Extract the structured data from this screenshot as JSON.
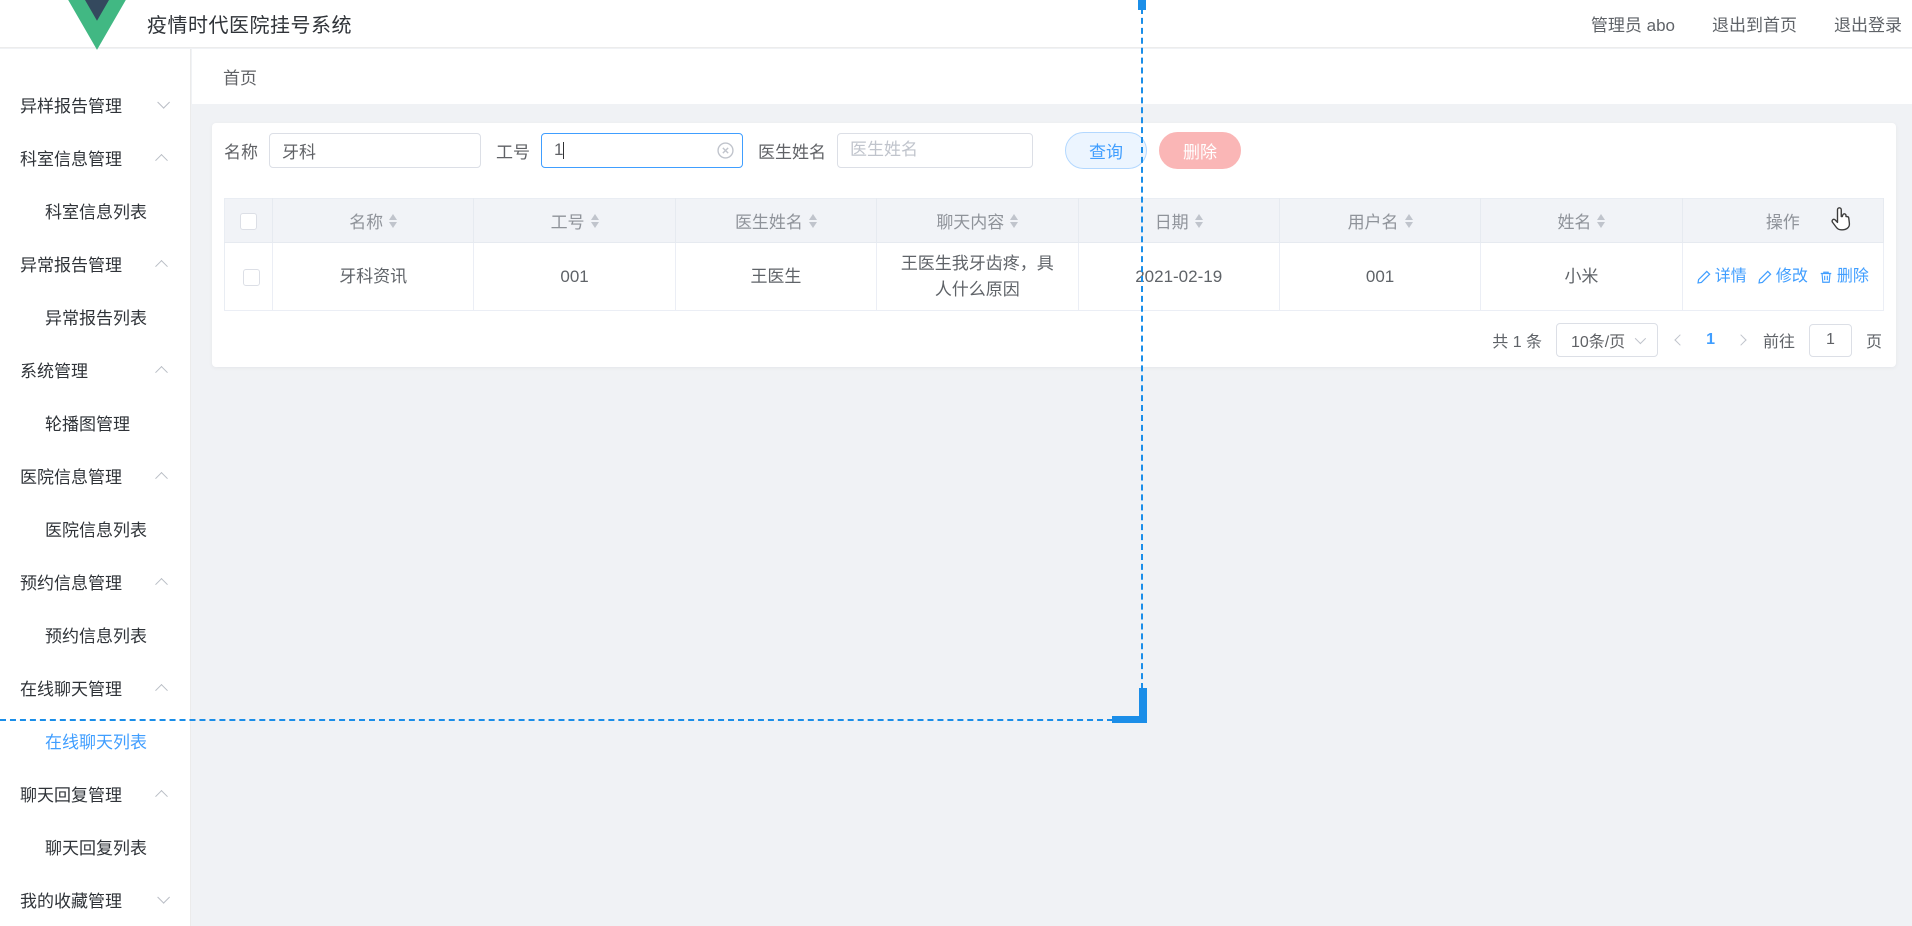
{
  "header": {
    "title": "疫情时代医院挂号系统",
    "user": "管理员 abo",
    "exit_home": "退出到首页",
    "logout": "退出登录"
  },
  "breadcrumb": {
    "home": "首页"
  },
  "sidebar": {
    "items": [
      {
        "label": "异样报告管理",
        "type": "parent",
        "state": "collapsed"
      },
      {
        "label": "科室信息管理",
        "type": "parent",
        "state": "expanded"
      },
      {
        "label": "科室信息列表",
        "type": "child",
        "active": false
      },
      {
        "label": "异常报告管理",
        "type": "parent",
        "state": "expanded"
      },
      {
        "label": "异常报告列表",
        "type": "child",
        "active": false
      },
      {
        "label": "系统管理",
        "type": "parent",
        "state": "expanded"
      },
      {
        "label": "轮播图管理",
        "type": "child",
        "active": false
      },
      {
        "label": "医院信息管理",
        "type": "parent",
        "state": "expanded"
      },
      {
        "label": "医院信息列表",
        "type": "child",
        "active": false
      },
      {
        "label": "预约信息管理",
        "type": "parent",
        "state": "expanded"
      },
      {
        "label": "预约信息列表",
        "type": "child",
        "active": false
      },
      {
        "label": "在线聊天管理",
        "type": "parent",
        "state": "expanded"
      },
      {
        "label": "在线聊天列表",
        "type": "child",
        "active": true
      },
      {
        "label": "聊天回复管理",
        "type": "parent",
        "state": "expanded"
      },
      {
        "label": "聊天回复列表",
        "type": "child",
        "active": false
      },
      {
        "label": "我的收藏管理",
        "type": "parent",
        "state": "collapsed"
      }
    ]
  },
  "search": {
    "name_label": "名称",
    "name_value": "牙科",
    "worker_label": "工号",
    "worker_value": "1",
    "doctor_label": "医生姓名",
    "doctor_placeholder": "医生姓名",
    "query_button": "查询",
    "delete_button": "删除"
  },
  "table": {
    "columns": [
      "名称",
      "工号",
      "医生姓名",
      "聊天内容",
      "日期",
      "用户名",
      "姓名",
      "操作"
    ],
    "rows": [
      {
        "name": "牙科资讯",
        "worker_id": "001",
        "doctor": "王医生",
        "content": "王医生我牙齿疼，具人什么原因",
        "date": "2021-02-19",
        "username": "001",
        "realname": "小米"
      }
    ],
    "actions": {
      "detail": "详情",
      "edit": "修改",
      "delete": "删除"
    }
  },
  "pagination": {
    "total": "共 1 条",
    "page_size": "10条/页",
    "current": "1",
    "goto_label": "前往",
    "goto_value": "1",
    "page_label": "页"
  },
  "icons": {
    "logo": "vue-logo",
    "input_clear": "circle-close",
    "sort": "sort-carets",
    "detail": "edit-pencil",
    "edit": "edit-pencil",
    "delete": "trash",
    "page_size_arrow": "chevron-down",
    "prev": "chevron-left",
    "next": "chevron-right",
    "overlay": "selection-crosshair",
    "cursor": "hand-pointer"
  },
  "colors": {
    "primary": "#409EFF",
    "danger_disabled": "#fab6b6",
    "overlay_blue": "#1b8ee8",
    "table_header_bg": "#f1f3f7",
    "page_bg": "#f0f2f5"
  }
}
